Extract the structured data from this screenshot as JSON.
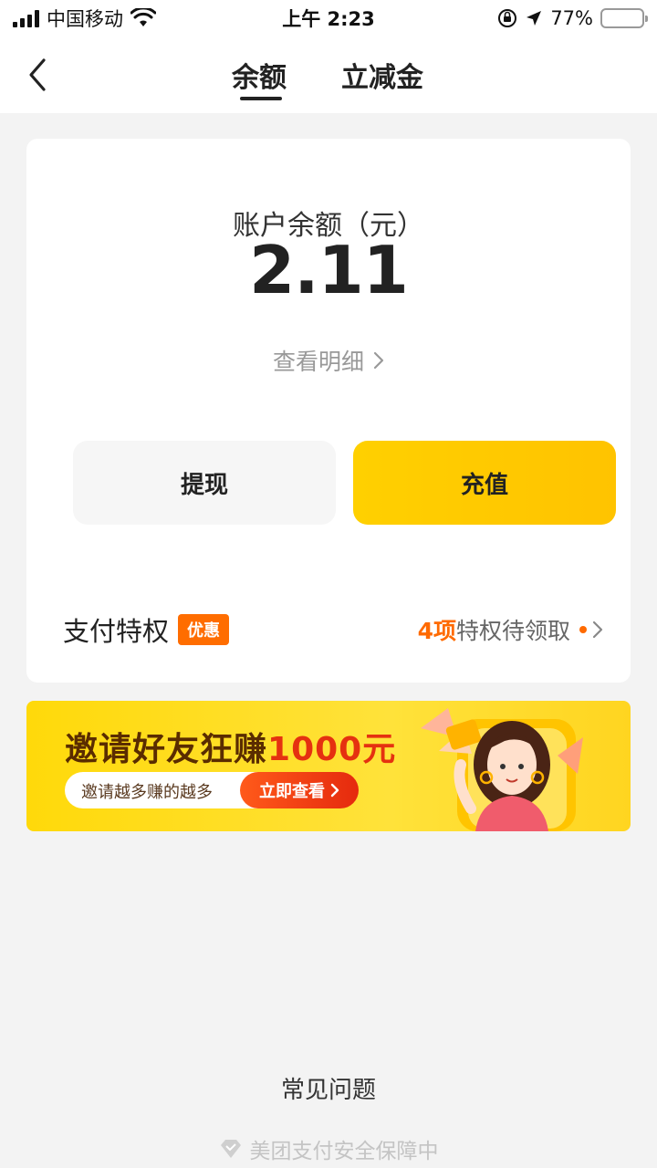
{
  "status_bar": {
    "carrier": "中国移动",
    "time": "上午 2:23",
    "battery": "77%",
    "battery_level": 0.77,
    "icons": [
      "signal-icon",
      "wifi-icon",
      "orientation-lock-icon",
      "location-icon",
      "battery-icon"
    ]
  },
  "nav": {
    "tabs": [
      {
        "label": "余额",
        "active": true
      },
      {
        "label": "立减金",
        "active": false
      }
    ]
  },
  "balance": {
    "label": "账户余额（元）",
    "value": "2.11",
    "details_link": "查看明细"
  },
  "actions": {
    "withdraw": "提现",
    "recharge": "充值"
  },
  "privilege": {
    "title": "支付特权",
    "badge": "优惠",
    "count": "4项",
    "suffix": "特权待领取"
  },
  "banner": {
    "title_prefix": "邀请好友狂赚",
    "title_highlight": "1000元",
    "subtitle": "邀请越多赚的越多",
    "cta": "立即查看"
  },
  "footer": {
    "faq": "常见问题",
    "security": "美团支付安全保障中"
  },
  "colors": {
    "accent": "#ffc300",
    "orange": "#ff6a00",
    "background": "#f3f3f3"
  }
}
